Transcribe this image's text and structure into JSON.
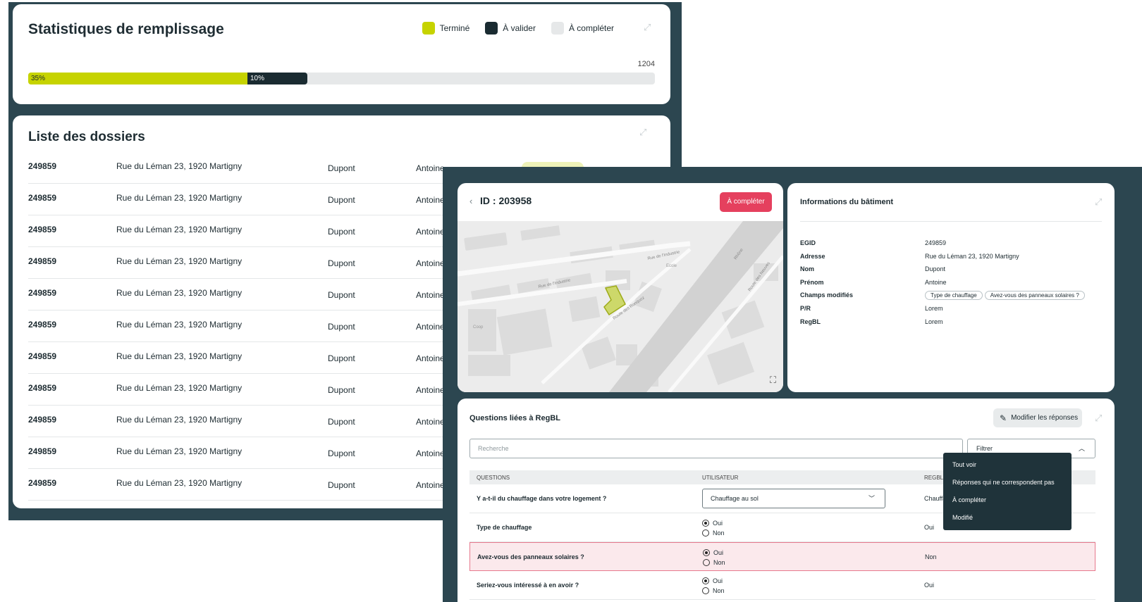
{
  "stats": {
    "title": "Statistiques de remplissage",
    "legend": [
      {
        "label": "Terminé",
        "color": "#c6d300"
      },
      {
        "label": "À valider",
        "color": "#1a2b31"
      },
      {
        "label": "À compléter",
        "color": "#e6e8e9"
      }
    ],
    "total": "1204",
    "done_label": "35%",
    "done_fraction": 0.35,
    "validate_label": "10%",
    "validate_fraction": 0.1
  },
  "list": {
    "title": "Liste des dossiers",
    "rows": [
      {
        "id": "249859",
        "address": "Rue du Léman 23, 1920 Martigny",
        "nom": "Dupont",
        "prenom": "Antoine"
      },
      {
        "id": "249859",
        "address": "Rue du Léman 23, 1920 Martigny",
        "nom": "Dupont",
        "prenom": "Antoine"
      },
      {
        "id": "249859",
        "address": "Rue du Léman 23, 1920 Martigny",
        "nom": "Dupont",
        "prenom": "Antoine"
      },
      {
        "id": "249859",
        "address": "Rue du Léman 23, 1920 Martigny",
        "nom": "Dupont",
        "prenom": "Antoine"
      },
      {
        "id": "249859",
        "address": "Rue du Léman 23, 1920 Martigny",
        "nom": "Dupont",
        "prenom": "Antoine"
      },
      {
        "id": "249859",
        "address": "Rue du Léman 23, 1920 Martigny",
        "nom": "Dupont",
        "prenom": "Antoine"
      },
      {
        "id": "249859",
        "address": "Rue du Léman 23, 1920 Martigny",
        "nom": "Dupont",
        "prenom": "Antoine"
      },
      {
        "id": "249859",
        "address": "Rue du Léman 23, 1920 Martigny",
        "nom": "Dupont",
        "prenom": "Antoine"
      },
      {
        "id": "249859",
        "address": "Rue du Léman 23, 1920 Martigny",
        "nom": "Dupont",
        "prenom": "Antoine"
      },
      {
        "id": "249859",
        "address": "Rue du Léman 23, 1920 Martigny",
        "nom": "Dupont",
        "prenom": "Antoine"
      },
      {
        "id": "249859",
        "address": "Rue du Léman 23, 1920 Martigny",
        "nom": "Dupont",
        "prenom": "Antoine"
      }
    ]
  },
  "building": {
    "id_label": "ID : 203958",
    "status_button": "À compléter",
    "map_labels": {
      "street1": "Rue de l'Industrie",
      "street2": "Rue de l'Industrie",
      "street3": "Route des Ronquoz",
      "street4": "Rhône",
      "street5": "Route des Neuves",
      "place1": "Coop",
      "place2": "Ecole"
    }
  },
  "info": {
    "title": "Informations du bâtiment",
    "rows": [
      {
        "key": "EGID",
        "value": "249859"
      },
      {
        "key": "Adresse",
        "value": "Rue du Léman 23, 1920 Martigny"
      },
      {
        "key": "Nom",
        "value": "Dupont"
      },
      {
        "key": "Prénom",
        "value": "Antoine"
      },
      {
        "key": "Champs modifiés",
        "value": ""
      },
      {
        "key": "P/R",
        "value": "Lorem"
      },
      {
        "key": "RegBL",
        "value": "Lorem"
      }
    ],
    "chips": [
      "Type de chauffage",
      "Avez-vous des panneaux solaires ?"
    ]
  },
  "questions": {
    "title": "Questions liées à RegBL",
    "edit_button": "Modifier les réponses",
    "search_placeholder": "Recherche",
    "filter_label": "Filtrer",
    "headers": {
      "q": "QUESTIONS",
      "user": "UTILISATEUR",
      "reg": "REGBL"
    },
    "rows": [
      {
        "question": "Y a-t-il du chauffage dans votre logement ?",
        "select": "Chauffage au sol",
        "regbl": "Chauffage"
      },
      {
        "question": "Type de chauffage",
        "oui": "Oui",
        "non": "Non",
        "regbl": "Oui"
      },
      {
        "question": "Avez-vous des panneaux solaires ?",
        "oui": "Oui",
        "non": "Non",
        "regbl": "Non"
      },
      {
        "question": "Seriez-vous intéressé à en avoir ?",
        "oui": "Oui",
        "non": "Non",
        "regbl": "Oui"
      }
    ],
    "dropdown": [
      "Tout voir",
      "Réponses qui ne correspondent pas",
      "À compléter",
      "Modifié"
    ]
  }
}
